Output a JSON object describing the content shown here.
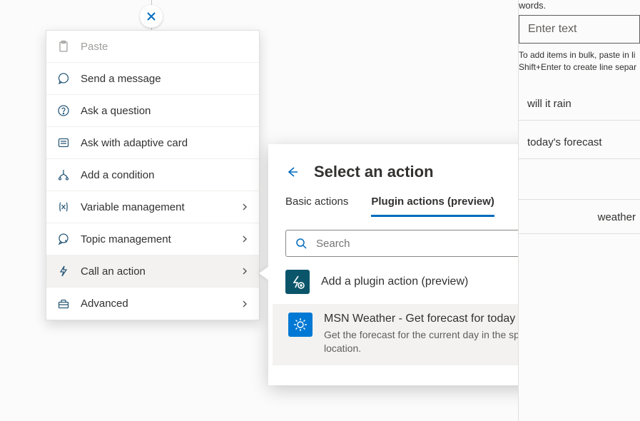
{
  "close_node_icon": "close-x",
  "context_menu": {
    "paste": "Paste",
    "send_message": "Send a message",
    "ask_question": "Ask a question",
    "ask_adaptive": "Ask with adaptive card",
    "add_condition": "Add a condition",
    "variable_mgmt": "Variable management",
    "topic_mgmt": "Topic management",
    "call_action": "Call an action",
    "advanced": "Advanced"
  },
  "action_panel": {
    "title": "Select an action",
    "tabs": {
      "basic": "Basic actions",
      "plugin": "Plugin actions (preview)"
    },
    "search_placeholder": "Search",
    "add_plugin": "Add a plugin action (preview)",
    "results": [
      {
        "title": "MSN Weather - Get forecast for today",
        "desc": "Get the forecast for the current day in the specified location."
      }
    ]
  },
  "side": {
    "label_tail": "words.",
    "enter_placeholder": "Enter text",
    "hint_line1": "To add items in bulk, paste in li",
    "hint_line2": "Shift+Enter to create line separ",
    "phrase1": "will it rain",
    "phrase2": "today's forecast",
    "phrase3_tail": "weather"
  }
}
